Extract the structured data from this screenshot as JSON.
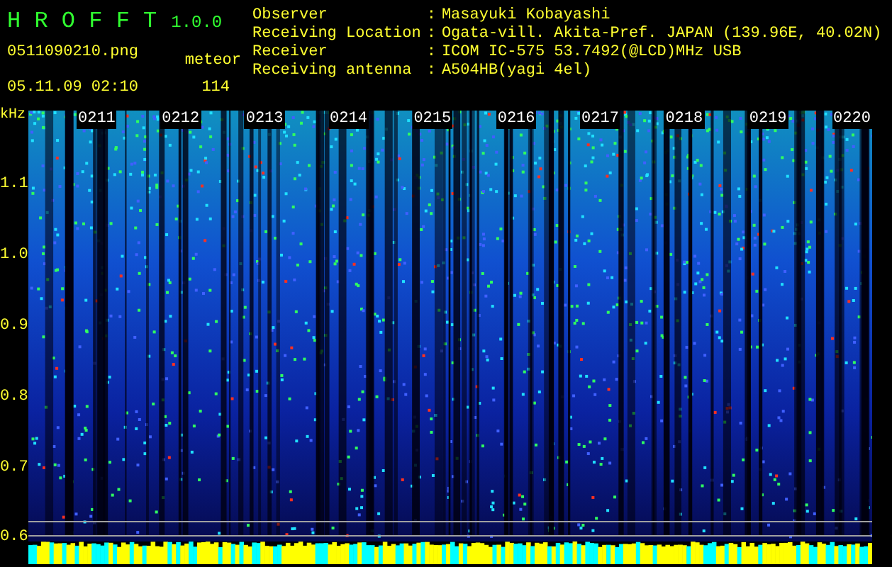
{
  "app": {
    "name": "H R O F F T",
    "version": "1.0.0",
    "file": "0511090210.png",
    "timestamp": "05.11.09 02:10",
    "count_label": "meteor",
    "count": "114"
  },
  "info": [
    {
      "label": "Observer",
      "separator": ":",
      "value": "Masayuki Kobayashi"
    },
    {
      "label": "Receiving Location",
      "separator": ":",
      "value": "Ogata-vill. Akita-Pref. JAPAN (139.96E, 40.02N)"
    },
    {
      "label": "Receiver",
      "separator": ":",
      "value": "ICOM IC-575 53.7492(@LCD)MHz USB"
    },
    {
      "label": "Receiving antenna",
      "separator": ":",
      "value": "A504HB(yagi 4el)"
    }
  ],
  "spectrogram": {
    "unit": "kHz",
    "freq_labels": [
      "1.1",
      "1.0",
      "0.9",
      "0.8",
      "0.7",
      "0.6"
    ],
    "time_labels": [
      "0211",
      "0212",
      "0213",
      "0214",
      "0215",
      "0216",
      "0217",
      "0218",
      "0219",
      "0220"
    ]
  }
}
